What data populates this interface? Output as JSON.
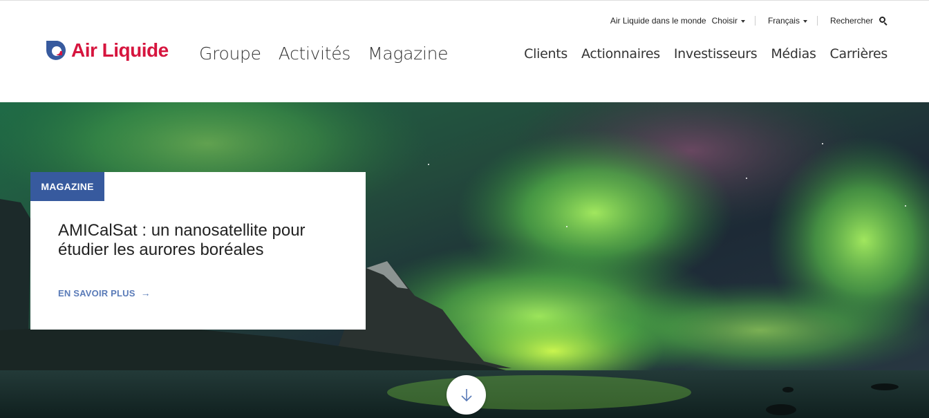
{
  "topbar": {
    "world_label": "Air Liquide dans le monde",
    "choose_label": "Choisir",
    "language_label": "Français",
    "search_label": "Rechercher"
  },
  "brand": {
    "name": "Air Liquide",
    "color": "#d6153e",
    "mark_color": "#375a9e"
  },
  "main_nav": [
    "Groupe",
    "Activités",
    "Magazine"
  ],
  "secondary_nav": [
    "Clients",
    "Actionnaires",
    "Investisseurs",
    "Médias",
    "Carrières"
  ],
  "hero": {
    "badge": "MAGAZINE",
    "title": "AMICalSat : un nanosatellite pour étudier les aurores boréales",
    "link_label": "EN SAVOIR PLUS",
    "link_icon": "arrow-right-icon",
    "scroll_icon": "arrow-down-icon",
    "badge_color": "#375a9e",
    "link_color": "#5a7bb8"
  }
}
